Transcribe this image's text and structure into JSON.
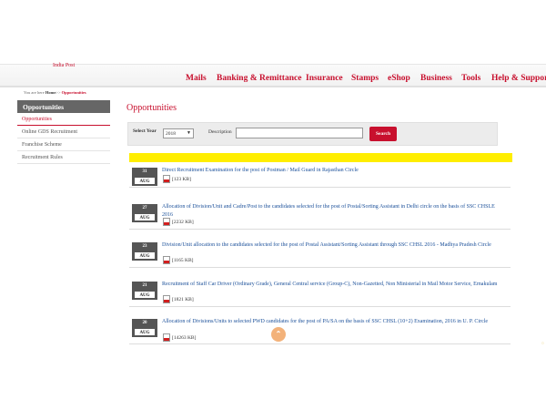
{
  "header": {
    "logo_text": "India Post",
    "nav": [
      {
        "label": "Mails",
        "name": "nav-mails"
      },
      {
        "label": "Banking & Remittance",
        "name": "nav-banking"
      },
      {
        "label": "Insurance",
        "name": "nav-insurance"
      },
      {
        "label": "Stamps",
        "name": "nav-stamps"
      },
      {
        "label": "eShop",
        "name": "nav-eshop"
      },
      {
        "label": "Business",
        "name": "nav-business"
      },
      {
        "label": "Tools",
        "name": "nav-tools"
      },
      {
        "label": "Help & Support",
        "name": "nav-help"
      }
    ]
  },
  "breadcrumb": {
    "prefix": "You are here",
    "home": "Home",
    "separator": ">>",
    "current": "Opportunities"
  },
  "sidebar": {
    "title": "Opportunities",
    "items": [
      {
        "label": "Opportunities",
        "active": true
      },
      {
        "label": "Online GDS Recruitment",
        "active": false
      },
      {
        "label": "Franchise Scheme",
        "active": false
      },
      {
        "label": "Recruitment Rules",
        "active": false
      }
    ]
  },
  "main": {
    "title": "Opportunities",
    "search": {
      "year_label": "Select Year",
      "year_value": "2018",
      "description_label": "Description",
      "description_value": "",
      "button_label": "Search"
    },
    "items": [
      {
        "day": "31",
        "month": "AUG",
        "title": "Direct Recruitment Examination for the post of Postman / Mail Guard in Rajasthan Circle",
        "size": "[123 KB]"
      },
      {
        "day": "27",
        "month": "AUG",
        "title": "Allocation of Division/Unit and Cadre/Post to the candidates selected for the post of Postal/Sorting Assistant in Delhi circle on the basis of SSC CHSLE 2016",
        "size": "[2232 KB]"
      },
      {
        "day": "23",
        "month": "AUG",
        "title": "Division/Unit allocation to the candidates selected for the post of Postal Assistant/Sorting Assistant through SSC CHSL 2016 - Madhya Pradesh Circle",
        "size": "[1165 KB]"
      },
      {
        "day": "21",
        "month": "AUG",
        "title": "Recruitment of Staff Car Driver (Ordinary Grade), General Central service (Group-C), Non-Gazetted, Non Ministerial in Mail Motor Service, Ernakulam",
        "size": "[1821 KB]"
      },
      {
        "day": "20",
        "month": "AUG",
        "title": "Allocation of Divisions/Units to selected PWD candidates for the post of PA/SA on the basis of SSC CHSL (10+2) Examination, 2016 in U. P. Circle",
        "size": "[14263 KB]"
      }
    ]
  },
  "colors": {
    "accent": "#c8102e",
    "link": "#1a4f99",
    "highlight": "#ffee00"
  }
}
